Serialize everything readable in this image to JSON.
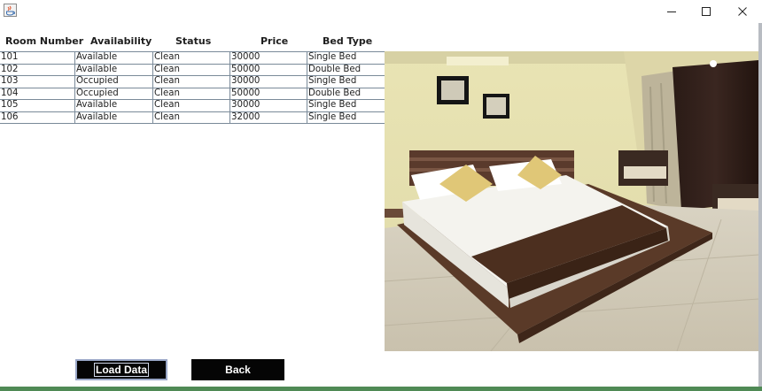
{
  "window": {
    "title": ""
  },
  "table": {
    "columns": [
      "Room Number",
      "Availability",
      "Status",
      "Price",
      "Bed Type"
    ],
    "rows": [
      [
        "101",
        "Available",
        "Clean",
        "30000",
        "Single Bed"
      ],
      [
        "102",
        "Available",
        "Clean",
        "50000",
        "Double Bed"
      ],
      [
        "103",
        "Occupied",
        "Clean",
        "30000",
        "Single Bed"
      ],
      [
        "104",
        "Occupied",
        "Clean",
        "50000",
        "Double Bed"
      ],
      [
        "105",
        "Available",
        "Clean",
        "30000",
        "Single Bed"
      ],
      [
        "106",
        "Available",
        "Clean",
        "32000",
        "Single Bed"
      ]
    ]
  },
  "buttons": {
    "load_label": "Load Data",
    "back_label": "Back"
  },
  "colors": {
    "button_bg": "#050505",
    "button_text": "#ffffff",
    "grid_line": "#7a8a99"
  }
}
